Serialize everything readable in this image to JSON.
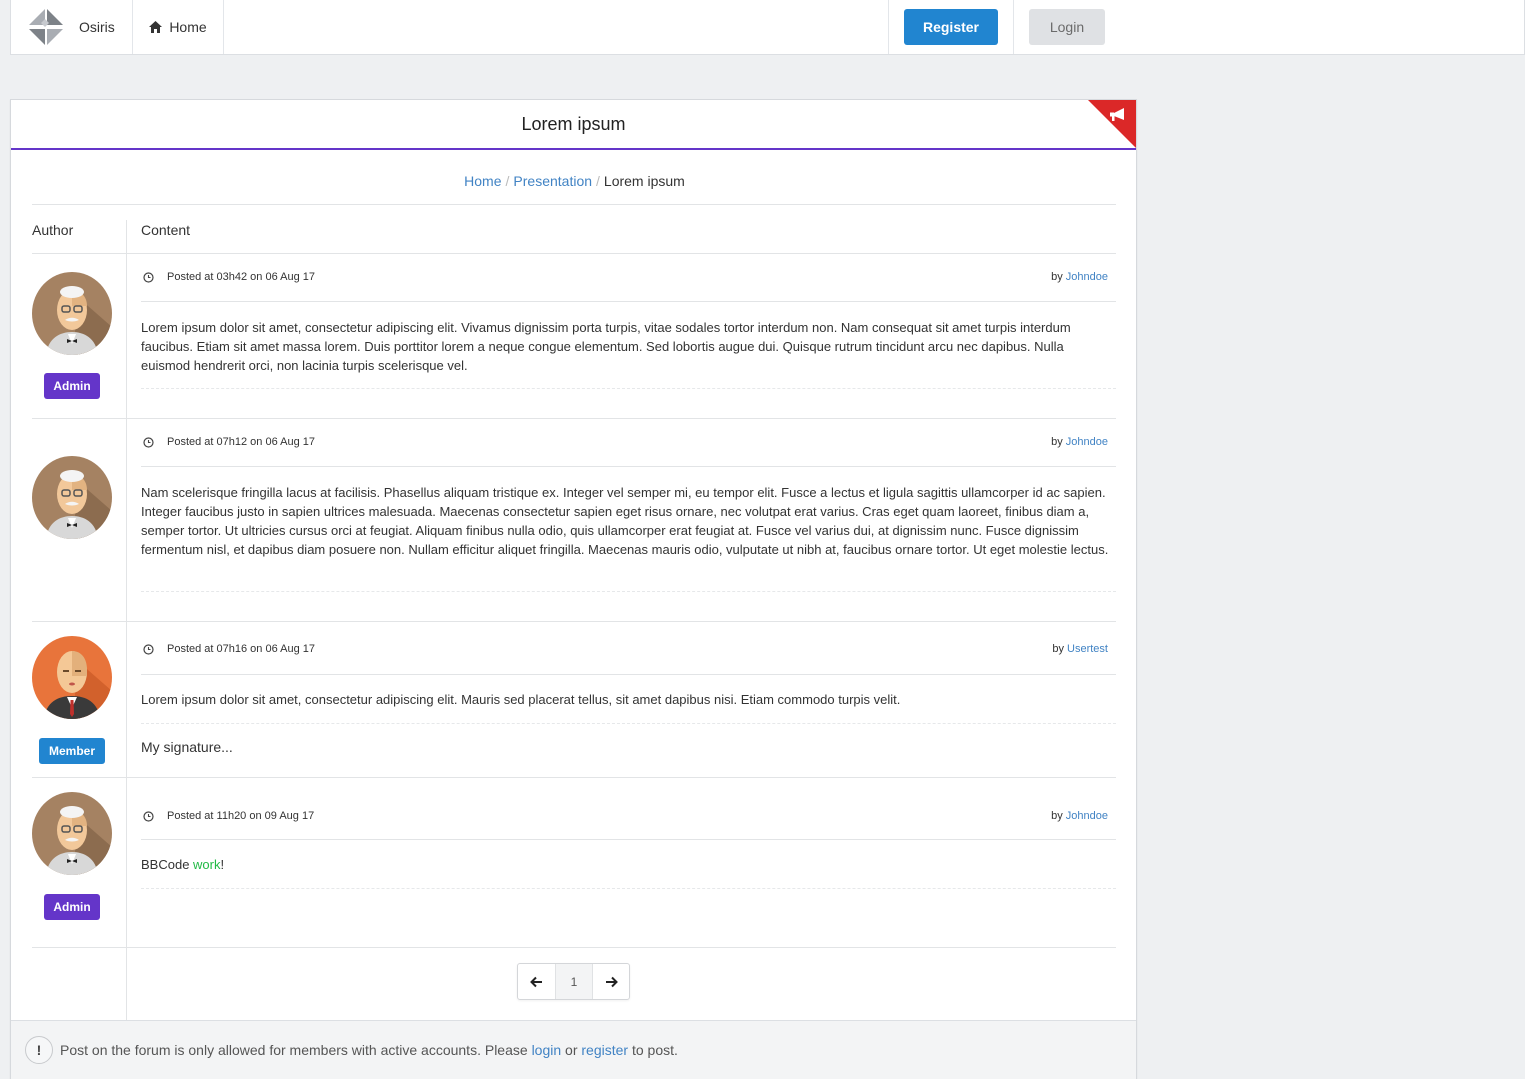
{
  "navbar": {
    "brand_name": "Osiris",
    "home_label": "Home",
    "register_label": "Register",
    "login_label": "Login"
  },
  "panel": {
    "title": "Lorem ipsum",
    "breadcrumb": {
      "home": "Home",
      "presentation": "Presentation",
      "current": "Lorem ipsum",
      "separator": "/"
    },
    "columns": {
      "author": "Author",
      "content": "Content"
    }
  },
  "posts": [
    {
      "posted": "Posted at 03h42 on 06 Aug 17",
      "by_prefix": "by",
      "author": "Johndoe",
      "role": "Admin",
      "body": "Lorem ipsum dolor sit amet, consectetur adipiscing elit. Vivamus dignissim porta turpis, vitae sodales tortor interdum non. Nam consequat sit amet turpis interdum faucibus. Etiam sit amet massa lorem. Duis porttitor lorem a neque congue elementum. Sed lobortis augue dui. Quisque rutrum tincidunt arcu nec dapibus. Nulla euismod hendrerit orci, non lacinia turpis scelerisque vel."
    },
    {
      "posted": "Posted at 07h12 on 06 Aug 17",
      "by_prefix": "by",
      "author": "Johndoe",
      "role": "Admin",
      "body": "Nam scelerisque fringilla lacus at facilisis. Phasellus aliquam tristique ex. Integer vel semper mi, eu tempor elit. Fusce a lectus et ligula sagittis ullamcorper id ac sapien. Integer faucibus justo in sapien ultrices malesuada. Maecenas consectetur sapien eget risus ornare, nec volutpat erat varius. Cras eget quam laoreet, finibus diam a, semper tortor. Ut ultricies cursus orci at feugiat. Aliquam finibus nulla odio, quis ullamcorper erat feugiat at. Fusce vel varius dui, at dignissim nunc. Fusce dignissim fermentum nisl, et dapibus diam posuere non. Nullam efficitur aliquet fringilla. Maecenas mauris odio, vulputate ut nibh at, faucibus ornare tortor. Ut eget molestie lectus."
    },
    {
      "posted": "Posted at 07h16 on 06 Aug 17",
      "by_prefix": "by",
      "author": "Usertest",
      "role": "Member",
      "body": "Lorem ipsum dolor sit amet, consectetur adipiscing elit. Mauris sed placerat tellus, sit amet dapibus nisi. Etiam commodo turpis velit.",
      "signature": "My signature..."
    },
    {
      "posted": "Posted at 11h20 on 09 Aug 17",
      "by_prefix": "by",
      "author": "Johndoe",
      "role": "Admin",
      "body_plain": "BBCode ",
      "body_green": "work",
      "body_end": "!"
    }
  ],
  "pagination": {
    "current_page": "1"
  },
  "footer": {
    "excl": "!",
    "text_before": "Post on the forum is only allowed for members with active accounts. Please ",
    "login_link": "login",
    "text_or": " or ",
    "register_link": "register",
    "text_after": " to post."
  },
  "colors": {
    "primary_blue": "#2185d0",
    "admin_purple": "#6435c9",
    "ribbon_red": "#db2828",
    "link_blue": "#4183c4",
    "bbcode_green": "#21ba45"
  },
  "icons": [
    "osiris-logo-icon",
    "home-icon",
    "megaphone-icon",
    "clock-icon",
    "arrow-left-icon",
    "arrow-right-icon",
    "exclamation-icon"
  ]
}
